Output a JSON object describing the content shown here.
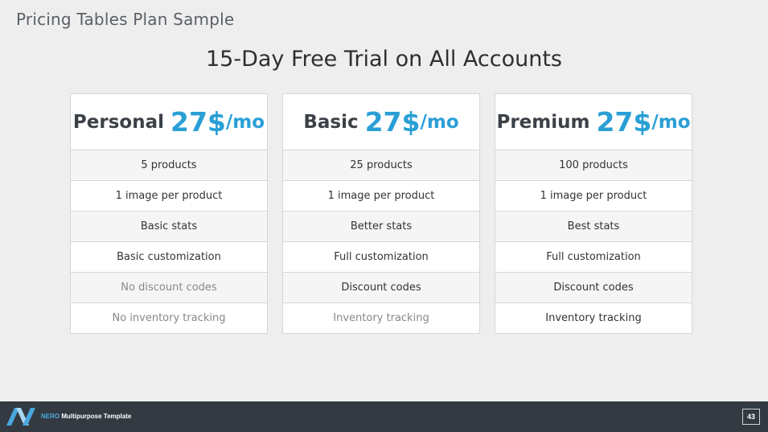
{
  "page": {
    "heading": "Pricing Tables Plan Sample",
    "title": "15-Day Free Trial on All Accounts"
  },
  "colors": {
    "accent": "#2a9fd6",
    "footer": "#333a42"
  },
  "plans": [
    {
      "name": "Personal",
      "price": "27$",
      "period": "/mo",
      "features": [
        {
          "text": "5 products",
          "enabled": true
        },
        {
          "text": "1  image per product",
          "enabled": true
        },
        {
          "text": "Basic stats",
          "enabled": true
        },
        {
          "text": "Basic customization",
          "enabled": true
        },
        {
          "text": "No discount codes",
          "enabled": false
        },
        {
          "text": "No inventory tracking",
          "enabled": false
        }
      ]
    },
    {
      "name": "Basic",
      "price": "27$",
      "period": "/mo",
      "features": [
        {
          "text": "25 products",
          "enabled": true
        },
        {
          "text": "1  image per product",
          "enabled": true
        },
        {
          "text": "Better stats",
          "enabled": true
        },
        {
          "text": "Full customization",
          "enabled": true
        },
        {
          "text": "Discount codes",
          "enabled": true
        },
        {
          "text": "Inventory tracking",
          "enabled": false
        }
      ]
    },
    {
      "name": "Premium",
      "price": "27$",
      "period": "/mo",
      "features": [
        {
          "text": "100 products",
          "enabled": true
        },
        {
          "text": "1  image per product",
          "enabled": true
        },
        {
          "text": "Best stats",
          "enabled": true
        },
        {
          "text": "Full customization",
          "enabled": true
        },
        {
          "text": "Discount codes",
          "enabled": true
        },
        {
          "text": "Inventory tracking",
          "enabled": true
        }
      ]
    }
  ],
  "footer": {
    "logo_icon": "nero-logo-icon",
    "brand": "NERO",
    "text": " Multipurpose Template",
    "page_number": "43"
  }
}
